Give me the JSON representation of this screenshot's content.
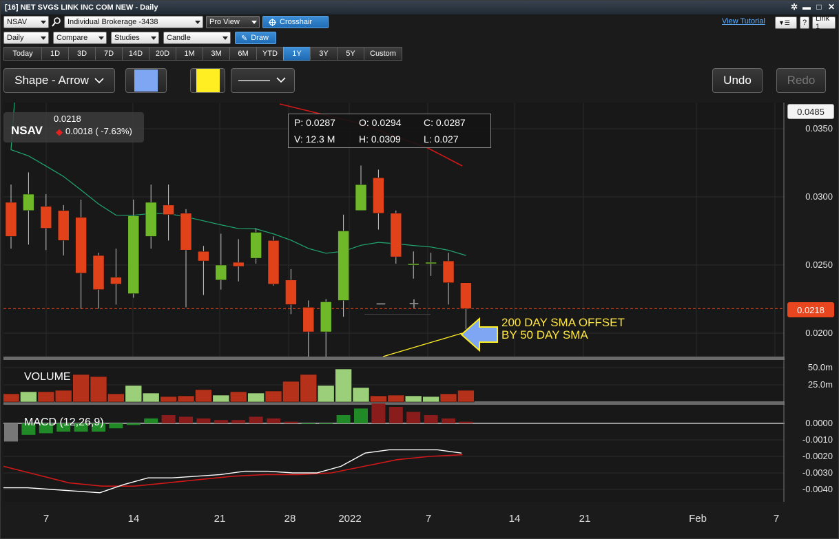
{
  "window": {
    "title": "[16] NET SVGS LINK INC COM NEW - Daily",
    "buttons": [
      "✲",
      "▬",
      "□",
      "✕"
    ]
  },
  "toolbar1": {
    "symbol": "NSAV",
    "account": "Individual Brokerage -3438",
    "view": "Pro View",
    "crosshair": "Crosshair",
    "view_tutorial": "View Tutorial",
    "help": "?",
    "link": "Link 1"
  },
  "toolbar2": {
    "interval": "Daily",
    "compare": "Compare",
    "studies": "Studies",
    "chart_type": "Candle",
    "draw": "Draw"
  },
  "timeframes": [
    "Today",
    "1D",
    "3D",
    "7D",
    "14D",
    "20D",
    "1M",
    "3M",
    "6M",
    "YTD",
    "1Y",
    "3Y",
    "5Y",
    "Custom"
  ],
  "active_timeframe": "1Y",
  "drawbar": {
    "shape": "Shape - Arrow",
    "undo": "Undo",
    "redo": "Redo",
    "fill_color": "#7ea6f2",
    "line_color": "#ffee22"
  },
  "quote": {
    "symbol": "NSAV",
    "last": "0.0218",
    "change": "0.0018 ( -7.63%)"
  },
  "ohlc": {
    "p": "P: 0.0287",
    "o": "O: 0.0294",
    "c": "C: 0.0287",
    "v": "V: 12.3 M",
    "h": "H: 0.0309",
    "l": "L: 0.027"
  },
  "annotation": {
    "line1": "200 DAY SMA OFFSET",
    "line2": "BY 50 DAY SMA"
  },
  "price_axis": {
    "top_tag": "0.0485",
    "current_tag": "0.0218",
    "ticks": [
      "0.0350",
      "0.0300",
      "0.0250",
      "0.0200"
    ]
  },
  "volume_panel": {
    "label": "VOLUME",
    "ticks": [
      "50.0m",
      "25.0m"
    ]
  },
  "macd_panel": {
    "label": "MACD (12,26,9)",
    "ticks": [
      "0.0000",
      "-0.0010",
      "-0.0020",
      "-0.0030",
      "-0.0040"
    ]
  },
  "x_axis": [
    "7",
    "14",
    "21",
    "28",
    "2022",
    "7",
    "14",
    "21",
    "Feb",
    "7"
  ],
  "colors": {
    "up": "#6fb82a",
    "down": "#e2421a",
    "sma50": "#1fa870",
    "sma200": "#d01818",
    "accent": "#1f6cb6"
  },
  "chart_data": {
    "type": "candlestick",
    "candles": [
      {
        "o": 0.0296,
        "h": 0.0309,
        "l": 0.0262,
        "c": 0.0271
      },
      {
        "o": 0.029,
        "h": 0.0318,
        "l": 0.0265,
        "c": 0.0302
      },
      {
        "o": 0.0293,
        "h": 0.0302,
        "l": 0.0261,
        "c": 0.0277
      },
      {
        "o": 0.029,
        "h": 0.0294,
        "l": 0.0257,
        "c": 0.0268
      },
      {
        "o": 0.0285,
        "h": 0.0298,
        "l": 0.0218,
        "c": 0.0244
      },
      {
        "o": 0.0257,
        "h": 0.0259,
        "l": 0.0218,
        "c": 0.0232
      },
      {
        "o": 0.0241,
        "h": 0.0262,
        "l": 0.0221,
        "c": 0.0236
      },
      {
        "o": 0.0229,
        "h": 0.0298,
        "l": 0.0226,
        "c": 0.0286
      },
      {
        "o": 0.0271,
        "h": 0.0309,
        "l": 0.0262,
        "c": 0.0296
      },
      {
        "o": 0.0294,
        "h": 0.0309,
        "l": 0.0268,
        "c": 0.0287
      },
      {
        "o": 0.0288,
        "h": 0.0291,
        "l": 0.0219,
        "c": 0.0261
      },
      {
        "o": 0.026,
        "h": 0.0264,
        "l": 0.0228,
        "c": 0.0253
      },
      {
        "o": 0.0239,
        "h": 0.0273,
        "l": 0.0232,
        "c": 0.025
      },
      {
        "o": 0.0252,
        "h": 0.0269,
        "l": 0.0238,
        "c": 0.0249
      },
      {
        "o": 0.0255,
        "h": 0.0277,
        "l": 0.0251,
        "c": 0.0274
      },
      {
        "o": 0.0268,
        "h": 0.0271,
        "l": 0.0235,
        "c": 0.0236
      },
      {
        "o": 0.0239,
        "h": 0.0247,
        "l": 0.0214,
        "c": 0.0221
      },
      {
        "o": 0.0219,
        "h": 0.0224,
        "l": 0.0182,
        "c": 0.0201
      },
      {
        "o": 0.0201,
        "h": 0.0225,
        "l": 0.0182,
        "c": 0.0223
      },
      {
        "o": 0.0224,
        "h": 0.0287,
        "l": 0.0212,
        "c": 0.0275
      },
      {
        "o": 0.029,
        "h": 0.0323,
        "l": 0.029,
        "c": 0.0309
      },
      {
        "o": 0.0314,
        "h": 0.032,
        "l": 0.0276,
        "c": 0.0288
      },
      {
        "o": 0.0288,
        "h": 0.029,
        "l": 0.0251,
        "c": 0.0256
      },
      {
        "o": 0.0251,
        "h": 0.026,
        "l": 0.024,
        "c": 0.0251
      },
      {
        "o": 0.0251,
        "h": 0.0259,
        "l": 0.0242,
        "c": 0.0252
      },
      {
        "o": 0.0253,
        "h": 0.0259,
        "l": 0.0221,
        "c": 0.0237
      },
      {
        "o": 0.0237,
        "h": 0.0237,
        "l": 0.0203,
        "c": 0.0218
      }
    ],
    "volume_millions": [
      12,
      15,
      15,
      17,
      40,
      37,
      12,
      24,
      13,
      8,
      9,
      18,
      10,
      15,
      13,
      16,
      30,
      40,
      24,
      48,
      21,
      9,
      10,
      9,
      8,
      12,
      17
    ],
    "macd_hist": [
      -0.0011,
      -0.0007,
      -0.0006,
      -0.0005,
      -0.0005,
      -0.0005,
      -0.0003,
      -0.0001,
      0.0003,
      0.0005,
      0.0004,
      0.0003,
      0.0002,
      0.0002,
      0.0004,
      0.0003,
      0.0001,
      0.0,
      0.0,
      0.0005,
      0.0009,
      0.0012,
      0.001,
      0.0007,
      0.0005,
      0.0003,
      0.0001
    ],
    "macd_line": [
      -0.0039,
      -0.0039,
      -0.004,
      -0.0041,
      -0.0042,
      -0.0037,
      -0.0033,
      -0.0033,
      -0.0032,
      -0.0031,
      -0.0029,
      -0.0029,
      -0.003,
      -0.003,
      -0.0026,
      -0.0018,
      -0.0016,
      -0.0016,
      -0.0016,
      -0.0018
    ],
    "signal_line": [
      -0.0026,
      -0.0031,
      -0.0036,
      -0.0038,
      -0.0038,
      -0.0036,
      -0.0034,
      -0.0032,
      -0.0031,
      -0.0031,
      -0.003,
      -0.0026,
      -0.0022,
      -0.002,
      -0.0019
    ]
  }
}
